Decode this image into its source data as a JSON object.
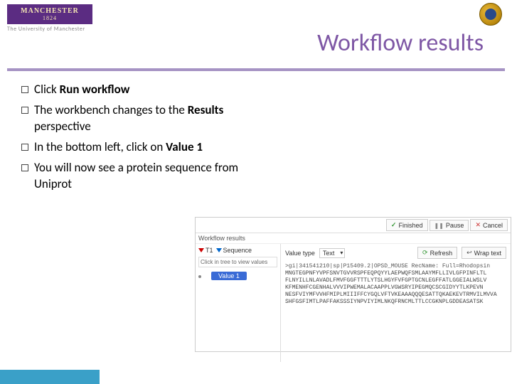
{
  "header": {
    "logo_top": "MANCHESTER",
    "logo_year": "1824",
    "logo_sub": "The University of Manchester",
    "title": "Workflow results"
  },
  "bullets": [
    {
      "pre": "Click ",
      "bold": "Run workflow",
      "post": ""
    },
    {
      "pre": "The workbench changes to the ",
      "bold": "Results",
      "post": " perspective"
    },
    {
      "pre": "In the bottom left, click on ",
      "bold": "Value 1",
      "post": ""
    },
    {
      "pre": "You will now see a protein sequence from Uniprot",
      "bold": "",
      "post": ""
    }
  ],
  "screenshot": {
    "panel_title": "Workflow results",
    "toolbar": {
      "finished": "Finished",
      "pause": "Pause",
      "cancel": "Cancel"
    },
    "left": {
      "tab_t1": "T1",
      "tab_seq": "Sequence",
      "hint": "Click in tree to view values",
      "value_label": "Value 1"
    },
    "right": {
      "value_type_label": "Value type",
      "value_type": "Text",
      "refresh": "Refresh",
      "wrap": "Wrap text",
      "seq_header": ">gi|341541210|sp|P15409.2|OPSD_MOUSE RecName: Full=Rhodopsin",
      "seq_lines": [
        "MNGTEGPNFYVPFSNVTGVVRSPFEQPQYYLAEPWQFSMLAAYMFLLIVLGFPINFLTL",
        "FLNYILLNLAVADLFMVFGGFTTTLYTSLHGYFVFGPTGCNLEGFFATLGGEIALWSLV",
        "KFMENHFCGENHALVVVIPWEMALACAAPPLVGWSRYIPEGMQCSCGIDYYTLKPEVN",
        "NESFVIYMFVVHFMIPLMIIIFFCYGQLVFTVKEAAAQQQESATTQKAEKEVTRMVILMVVA",
        "SHFGSFIMTLPAFFAKSSSIYNPVIYIMLNKQFRNCMLTTLCCGKNPLGDDEASATSK"
      ]
    }
  }
}
